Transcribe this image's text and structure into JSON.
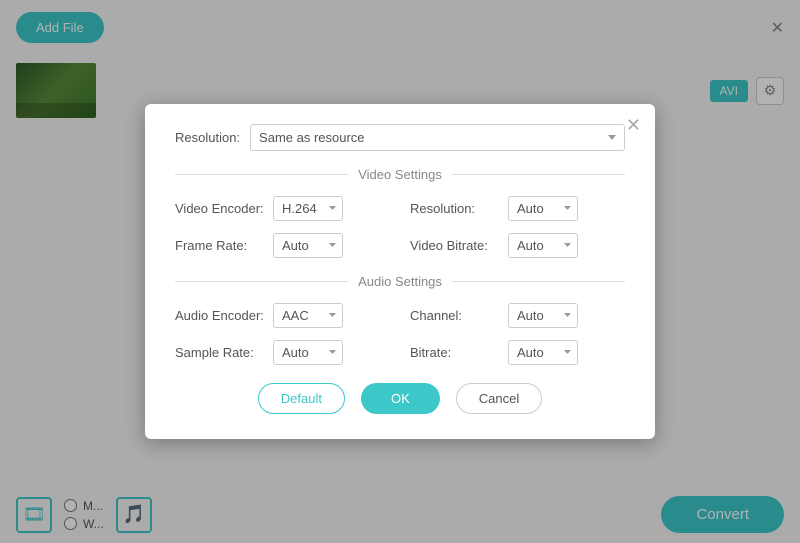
{
  "app": {
    "add_file_label": "Add File",
    "close_label": "✕",
    "format_label": "AVI",
    "convert_label": "Convert"
  },
  "bottom": {
    "radio1": "M...",
    "radio2": "W..."
  },
  "dialog": {
    "close_label": "✕",
    "resolution_label": "Resolution:",
    "resolution_value": "Same as resource",
    "video_settings_label": "Video Settings",
    "audio_settings_label": "Audio Settings",
    "fields": {
      "video_encoder_label": "Video Encoder:",
      "video_encoder_value": "H.264",
      "resolution_label": "Resolution:",
      "resolution_value": "Auto",
      "frame_rate_label": "Frame Rate:",
      "frame_rate_value": "Auto",
      "video_bitrate_label": "Video Bitrate:",
      "video_bitrate_value": "Auto",
      "audio_encoder_label": "Audio Encoder:",
      "audio_encoder_value": "AAC",
      "channel_label": "Channel:",
      "channel_value": "Auto",
      "sample_rate_label": "Sample Rate:",
      "sample_rate_value": "Auto",
      "bitrate_label": "Bitrate:",
      "bitrate_value": "Auto"
    },
    "buttons": {
      "default_label": "Default",
      "ok_label": "OK",
      "cancel_label": "Cancel"
    }
  }
}
